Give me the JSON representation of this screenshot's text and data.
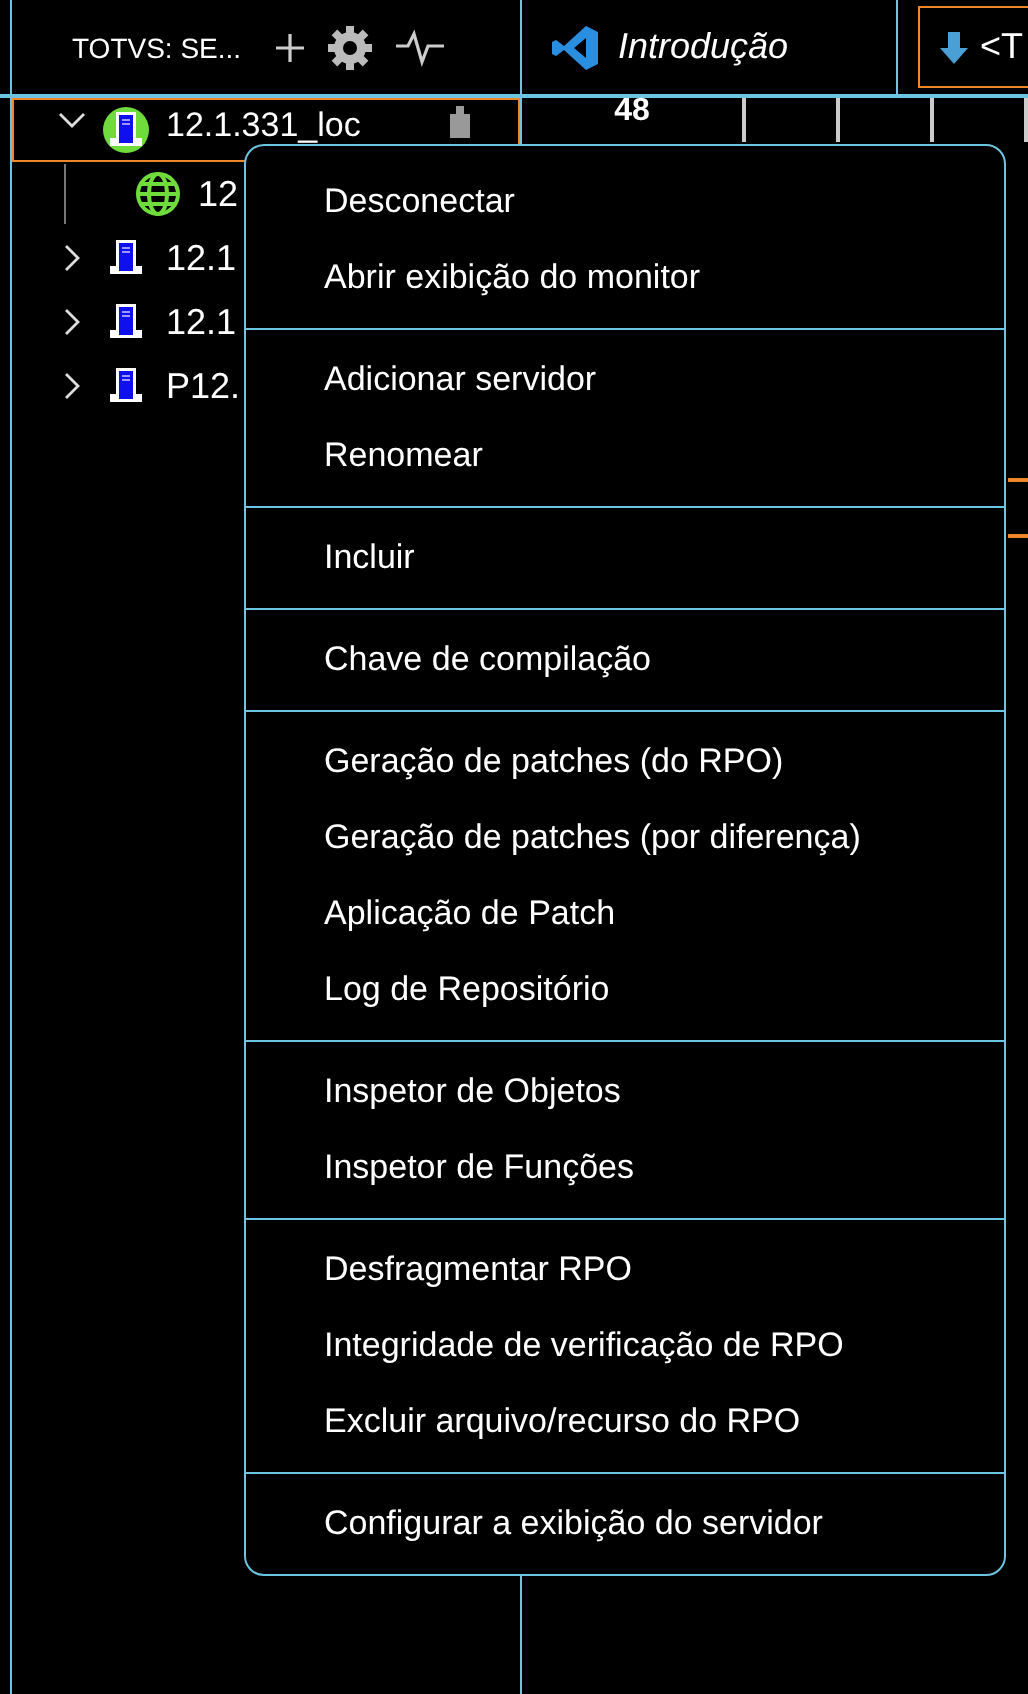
{
  "sidebar": {
    "title": "TOTVS: SE...",
    "tree": [
      {
        "label": "12.1.331_loc",
        "kind": "server",
        "connected": true,
        "selected": true,
        "expanded": true,
        "children": [
          {
            "label": "12",
            "kind": "environment"
          }
        ]
      },
      {
        "label": "12.1",
        "kind": "server",
        "connected": false,
        "selected": false,
        "expanded": false
      },
      {
        "label": "12.1",
        "kind": "server",
        "connected": false,
        "selected": false,
        "expanded": false
      },
      {
        "label": "P12.",
        "kind": "server",
        "connected": false,
        "selected": false,
        "expanded": false
      }
    ]
  },
  "tabs": [
    {
      "label": "Introdução",
      "selected": true,
      "focused": false
    },
    {
      "label": "<T",
      "selected": false,
      "focused": true
    }
  ],
  "editor": {
    "cell": "48"
  },
  "context_menu": {
    "groups": [
      [
        "Desconectar",
        "Abrir exibição do monitor"
      ],
      [
        "Adicionar servidor",
        "Renomear"
      ],
      [
        "Incluir"
      ],
      [
        "Chave de compilação"
      ],
      [
        "Geração de patches (do RPO)",
        "Geração de patches (por diferença)",
        "Aplicação de Patch",
        "Log de Repositório"
      ],
      [
        "Inspetor de Objetos",
        "Inspetor de Funções"
      ],
      [
        "Desfragmentar RPO",
        "Integridade de verificação de RPO",
        "Excluir arquivo/recurso do RPO"
      ],
      [
        "Configurar a exibição do servidor"
      ]
    ]
  }
}
